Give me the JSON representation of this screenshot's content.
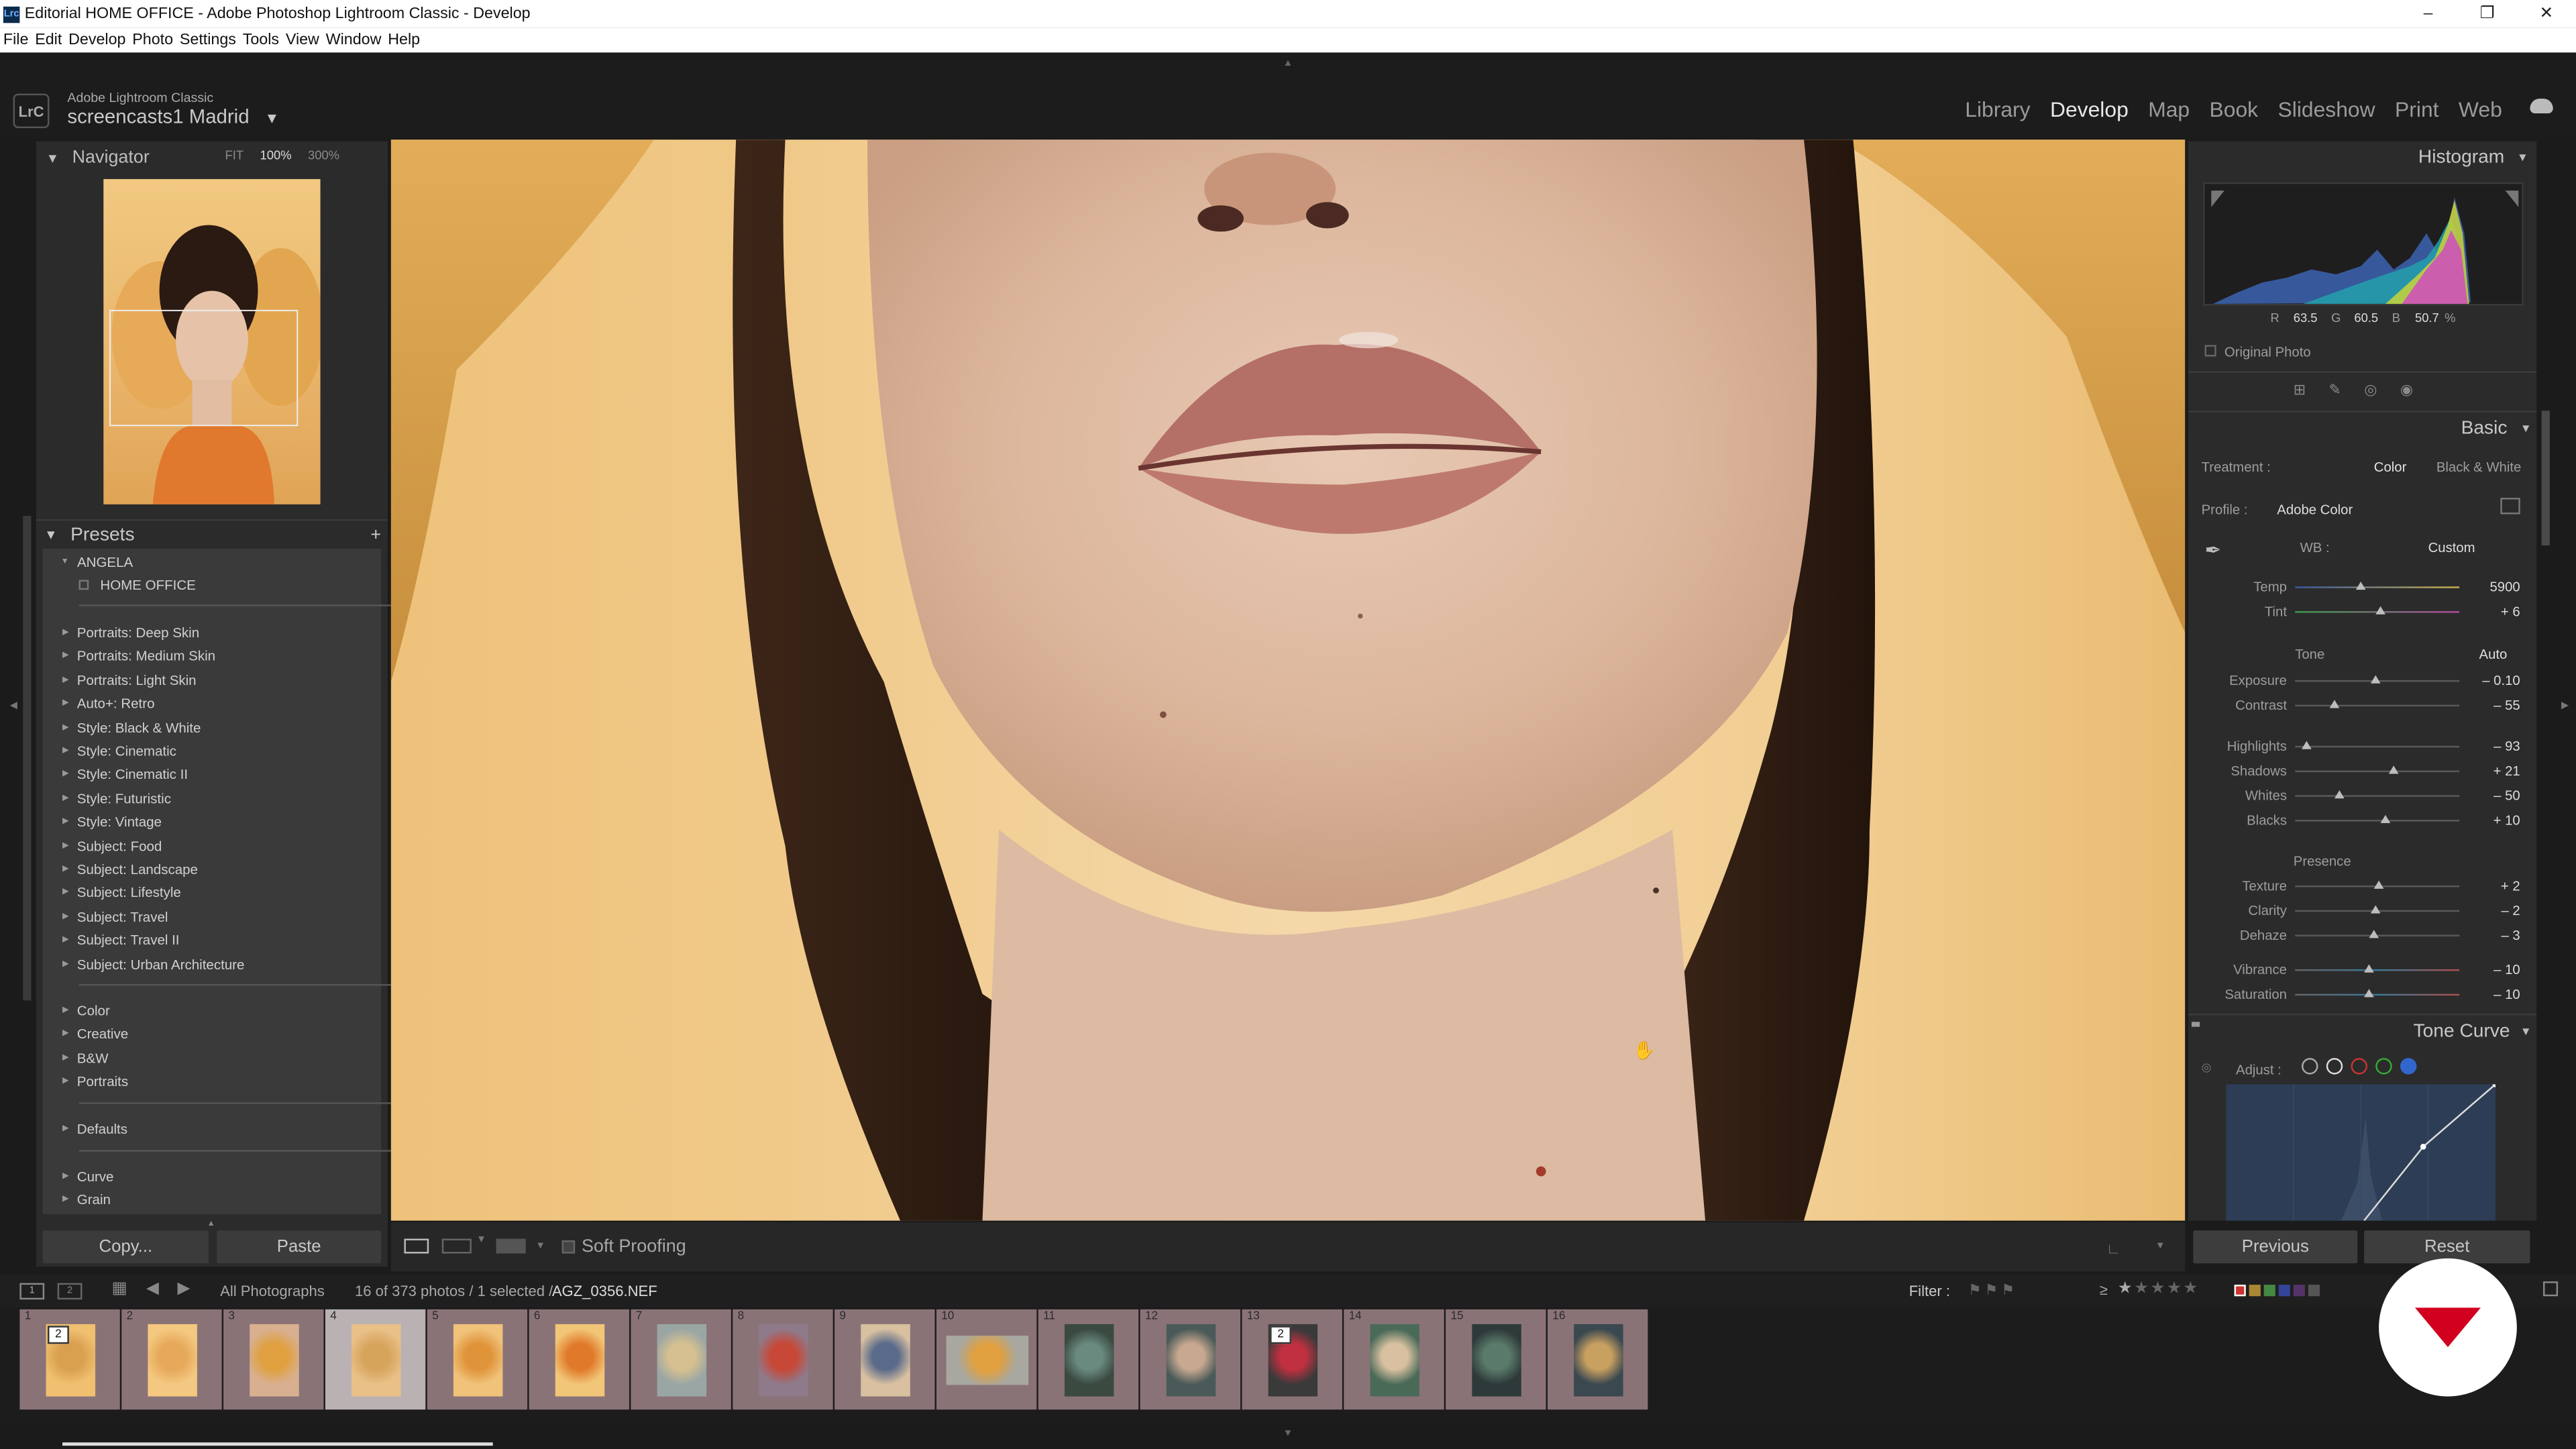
{
  "window": {
    "title": "Editorial HOME OFFICE - Adobe Photoshop Lightroom Classic - Develop",
    "app_icon": "Lrc"
  },
  "menu": [
    "File",
    "Edit",
    "Develop",
    "Photo",
    "Settings",
    "Tools",
    "View",
    "Window",
    "Help"
  ],
  "identity": {
    "app": "Adobe Lightroom Classic",
    "catalog": "screencasts1 Madrid"
  },
  "modules": [
    "Library",
    "Develop",
    "Map",
    "Book",
    "Slideshow",
    "Print",
    "Web"
  ],
  "navigator": {
    "title": "Navigator",
    "zoom": [
      "FIT",
      "100%",
      "300%"
    ]
  },
  "presets": {
    "title": "Presets",
    "group_open": "ANGELA",
    "group_child": "HOME OFFICE",
    "groups_a": [
      "Portraits: Deep Skin",
      "Portraits: Medium Skin",
      "Portraits: Light Skin",
      "Auto+: Retro",
      "Style: Black & White",
      "Style: Cinematic",
      "Style: Cinematic II",
      "Style: Futuristic",
      "Style: Vintage",
      "Subject: Food",
      "Subject: Landscape",
      "Subject: Lifestyle",
      "Subject: Travel",
      "Subject: Travel II",
      "Subject: Urban Architecture"
    ],
    "groups_b": [
      "Color",
      "Creative",
      "B&W",
      "Portraits"
    ],
    "groups_c": [
      "Defaults"
    ],
    "groups_d": [
      "Curve",
      "Grain"
    ]
  },
  "copy_paste": {
    "copy": "Copy...",
    "paste": "Paste"
  },
  "toolbar": {
    "soft_proofing": "Soft Proofing"
  },
  "histogram": {
    "title": "Histogram",
    "r_label": "R",
    "r": "63.5",
    "g_label": "G",
    "g": "60.5",
    "b_label": "B",
    "b": "50.7",
    "pct": "%",
    "original_photo": "Original Photo"
  },
  "basic": {
    "title": "Basic",
    "treatment_label": "Treatment :",
    "treatment_color": "Color",
    "treatment_bw": "Black & White",
    "profile_label": "Profile :",
    "profile_value": "Adobe Color",
    "wb_label": "WB :",
    "wb_value": "Custom",
    "tone_label": "Tone",
    "auto": "Auto",
    "presence_label": "Presence",
    "sliders": [
      {
        "label": "Temp",
        "value": "5900",
        "pos": 0.4
      },
      {
        "label": "Tint",
        "value": "+ 6",
        "pos": 0.52
      },
      {
        "label": "Exposure",
        "value": "– 0.10",
        "pos": 0.49
      },
      {
        "label": "Contrast",
        "value": "– 55",
        "pos": 0.24
      },
      {
        "label": "Highlights",
        "value": "– 93",
        "pos": 0.07
      },
      {
        "label": "Shadows",
        "value": "+ 21",
        "pos": 0.6
      },
      {
        "label": "Whites",
        "value": "– 50",
        "pos": 0.27
      },
      {
        "label": "Blacks",
        "value": "+ 10",
        "pos": 0.55
      },
      {
        "label": "Texture",
        "value": "+ 2",
        "pos": 0.51
      },
      {
        "label": "Clarity",
        "value": "– 2",
        "pos": 0.49
      },
      {
        "label": "Dehaze",
        "value": "– 3",
        "pos": 0.48
      },
      {
        "label": "Vibrance",
        "value": "– 10",
        "pos": 0.45
      },
      {
        "label": "Saturation",
        "value": "– 10",
        "pos": 0.45
      }
    ]
  },
  "tone_curve": {
    "title": "Tone Curve",
    "adjust_label": "Adjust :"
  },
  "prev_reset": {
    "previous": "Previous",
    "reset": "Reset"
  },
  "filmstrip": {
    "source": "All Photographs",
    "info": "16 of 373 photos / 1 selected /",
    "filename": "AGZ_0356.NEF",
    "filter_label": "Filter :",
    "rating_op": "≥",
    "cells": [
      {
        "num": "1",
        "badge": "2"
      },
      {
        "num": "2",
        "badge": ""
      },
      {
        "num": "3",
        "badge": ""
      },
      {
        "num": "4",
        "badge": ""
      },
      {
        "num": "5",
        "badge": ""
      },
      {
        "num": "6",
        "badge": ""
      },
      {
        "num": "7",
        "badge": ""
      },
      {
        "num": "8",
        "badge": ""
      },
      {
        "num": "9",
        "badge": ""
      },
      {
        "num": "10",
        "badge": ""
      },
      {
        "num": "11",
        "badge": ""
      },
      {
        "num": "12",
        "badge": ""
      },
      {
        "num": "13",
        "badge": "2"
      },
      {
        "num": "14",
        "badge": ""
      },
      {
        "num": "15",
        "badge": ""
      },
      {
        "num": "16",
        "badge": ""
      }
    ],
    "selected_index": 3
  },
  "colors": {
    "accent_red": "#d2001f",
    "panel": "#2b2b2b",
    "selected_cell": "#b9b1b2"
  }
}
